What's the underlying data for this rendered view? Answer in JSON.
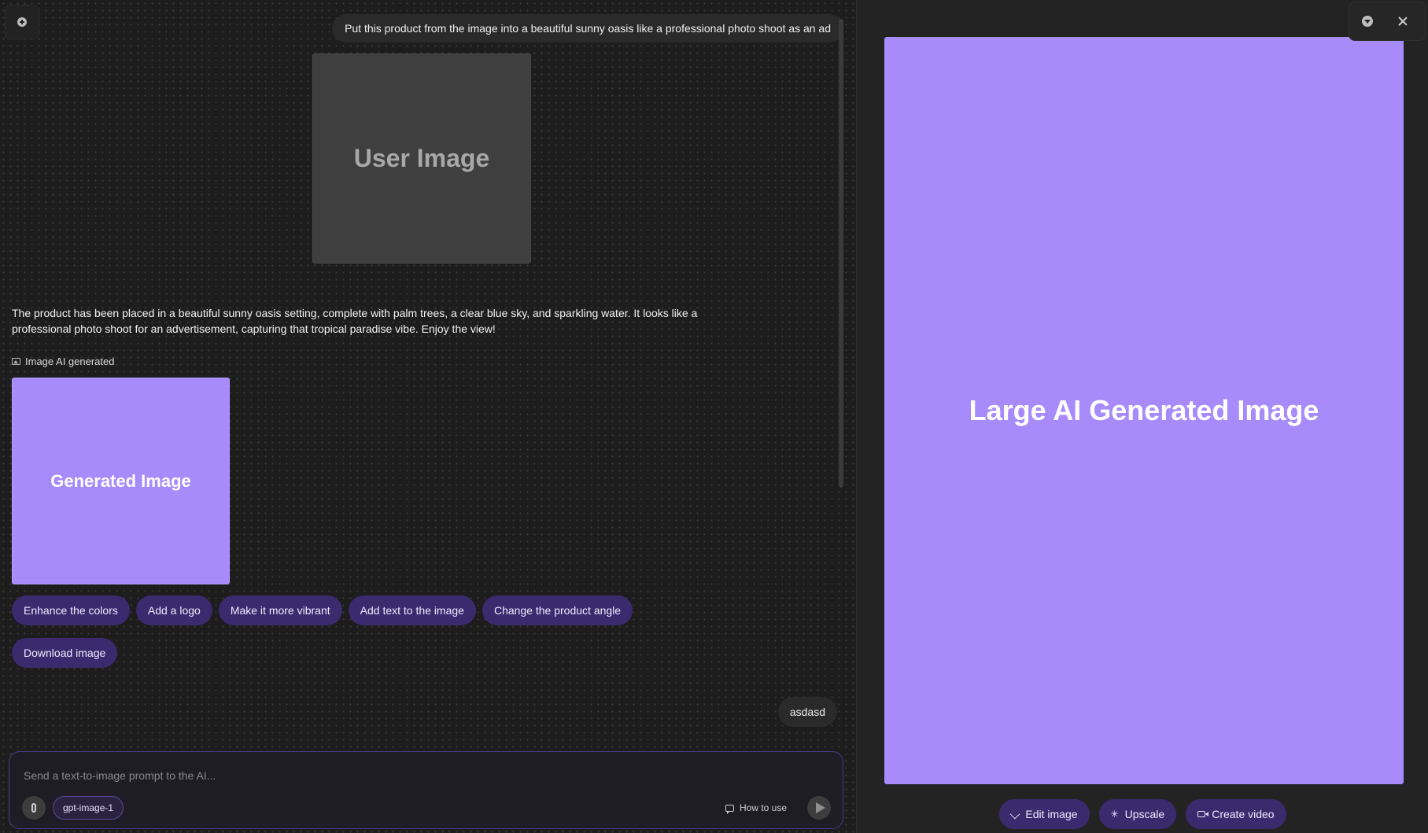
{
  "chat": {
    "user_prompt": "Put this product from the image into a beautiful sunny oasis like a professional photo shoot as an ad",
    "user_image_label": "User Image",
    "ai_response": "The product has been placed in a beautiful sunny oasis setting, complete with palm trees, a clear blue sky, and sparkling water. It looks like a professional photo shoot for an advertisement, capturing that tropical paradise vibe. Enjoy the view!",
    "generated_label": "Image AI generated",
    "generated_image_label": "Generated Image",
    "suggestions": [
      "Enhance the colors",
      "Add a logo",
      "Make it more vibrant",
      "Add text to the image",
      "Change the product angle",
      "Download image"
    ],
    "user_message_2": "asdasd"
  },
  "composer": {
    "placeholder": "Send a text-to-image prompt to the AI...",
    "model": "gpt-image-1",
    "how_to_label": "How to use"
  },
  "preview": {
    "large_image_label": "Large AI Generated Image",
    "actions": {
      "edit": "Edit image",
      "upscale": "Upscale",
      "video": "Create video"
    }
  },
  "colors": {
    "accent": "#a78bfa",
    "chip_bg": "#3b2a6e",
    "background": "#1d1d1d"
  },
  "icons": [
    "plus-circle-icon",
    "image-icon",
    "paperclip-icon",
    "chat-bubble-icon",
    "send-icon",
    "download-icon",
    "close-icon",
    "pencil-icon",
    "sparkle-icon",
    "video-icon"
  ]
}
